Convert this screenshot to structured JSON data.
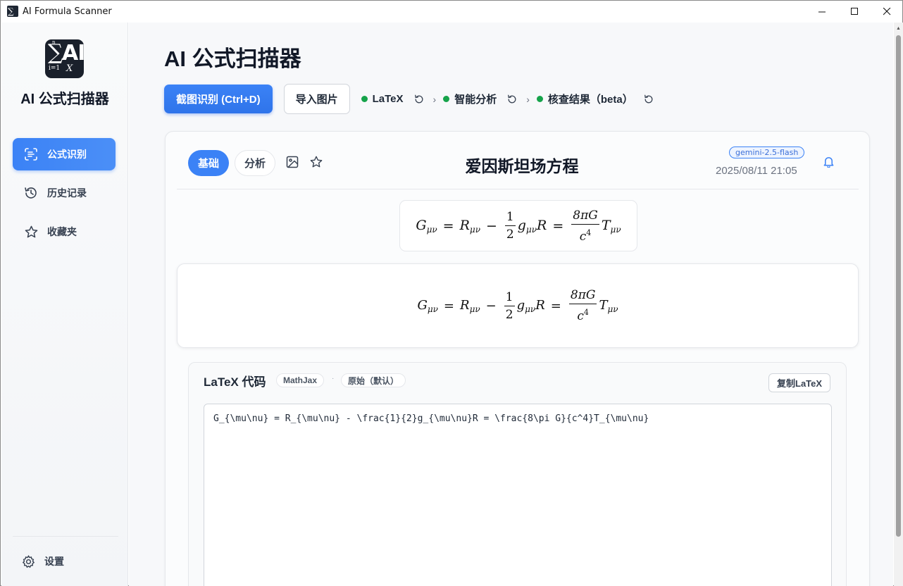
{
  "window": {
    "title": "AI Formula Scanner",
    "controls": {
      "minimize": "—",
      "maximize": "☐",
      "close": "✕"
    }
  },
  "sidebar": {
    "brand": "AI 公式扫描器",
    "logo_text": {
      "sigma": "∑",
      "ai": "AI",
      "lower": "i=1",
      "upper": "n",
      "x": "X",
      "x_sub": "i"
    },
    "items": [
      {
        "label": "公式识别",
        "icon": "scan-text-icon",
        "active": true
      },
      {
        "label": "历史记录",
        "icon": "history-icon",
        "active": false
      },
      {
        "label": "收藏夹",
        "icon": "star-icon",
        "active": false
      }
    ],
    "settings_label": "设置"
  },
  "main": {
    "title": "AI 公式扫描器",
    "toolbar": {
      "capture_label": "截图识别 (Ctrl+D)",
      "import_label": "导入图片",
      "steps": [
        {
          "label": "LaTeX",
          "status_color": "#16a34a"
        },
        {
          "label": "智能分析",
          "status_color": "#16a34a"
        },
        {
          "label": "核查结果（beta）",
          "status_color": "#16a34a"
        }
      ],
      "separator": "›"
    },
    "result": {
      "tabs": [
        {
          "label": "基础",
          "active": true
        },
        {
          "label": "分析",
          "active": false
        }
      ],
      "title": "爱因斯坦场方程",
      "model": "gemini-2.5-flash",
      "timestamp": "2025/08/11 21:05",
      "latex_panel": {
        "label": "LaTeX 代码",
        "engine": "MathJax",
        "separator": "·",
        "mode": "原始（默认）",
        "copy_label": "复制LaTeX",
        "code": "G_{\\mu\\nu} = R_{\\mu\\nu} - \\frac{1}{2}g_{\\mu\\nu}R = \\frac{8\\pi G}{c^4}T_{\\mu\\nu}"
      }
    }
  },
  "colors": {
    "accent": "#3b82f6",
    "success": "#16a34a"
  }
}
